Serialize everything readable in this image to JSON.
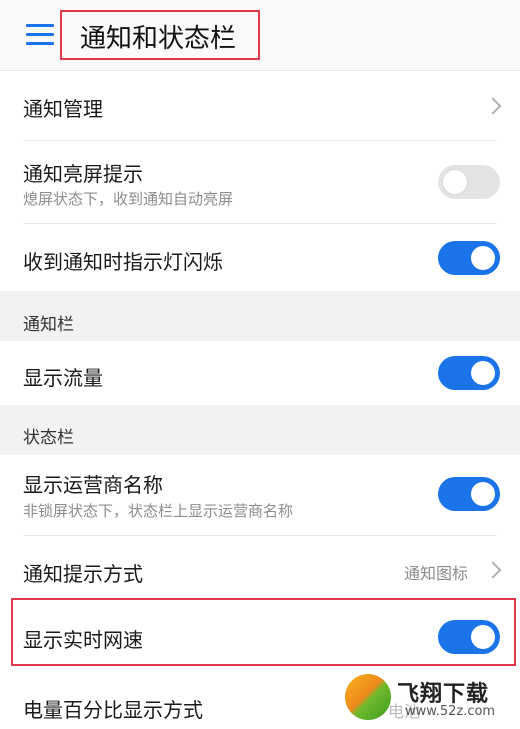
{
  "header": {
    "title": "通知和状态栏"
  },
  "rows": {
    "notification_management": {
      "label": "通知管理"
    },
    "notification_wake_screen": {
      "label": "通知亮屏提示",
      "sub": "熄屏状态下，收到通知自动亮屏",
      "enabled": false
    },
    "indicator_light": {
      "label": "收到通知时指示灯闪烁",
      "enabled": true
    },
    "show_data_usage": {
      "label": "显示流量",
      "enabled": true
    },
    "show_carrier_name": {
      "label": "显示运营商名称",
      "sub": "非锁屏状态下，状态栏上显示运营商名称",
      "enabled": true
    },
    "notification_style": {
      "label": "通知提示方式",
      "value": "通知图标"
    },
    "show_network_speed": {
      "label": "显示实时网速",
      "enabled": true
    },
    "battery_percentage": {
      "label": "电量百分比显示方式",
      "value": "电池"
    }
  },
  "sections": {
    "notification_bar": "通知栏",
    "status_bar": "状态栏"
  },
  "watermark": {
    "brand": "飞翔下载",
    "url": "www.52z.com"
  },
  "colors": {
    "accent": "#1a73e8",
    "highlight": "#e03a4a",
    "section_bg": "#f2f2f2"
  },
  "icons": {
    "menu": "hamburger-menu-icon",
    "chevron": "chevron-right-icon"
  }
}
